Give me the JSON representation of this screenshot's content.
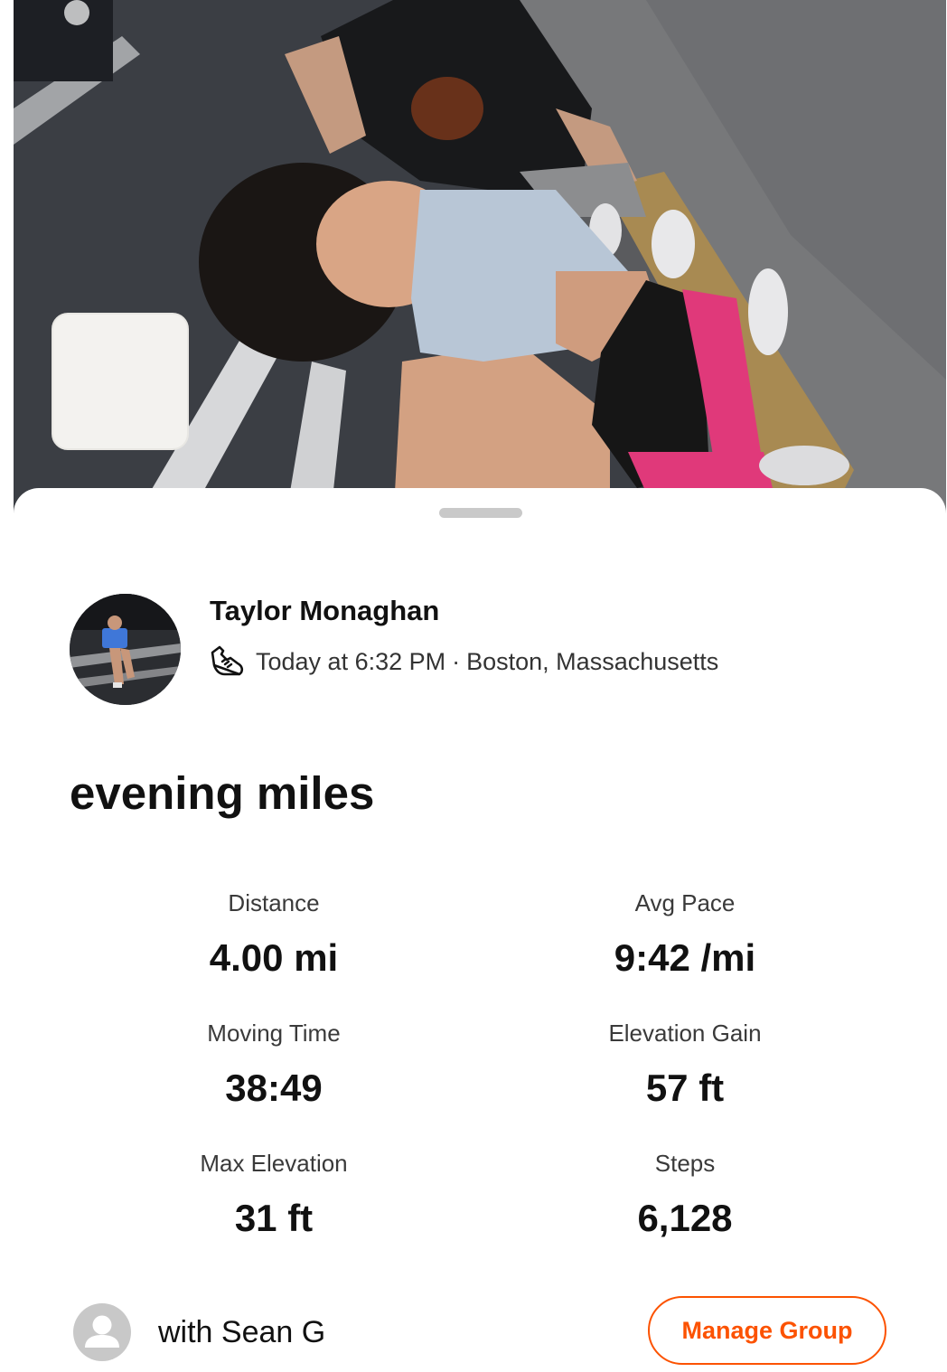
{
  "activity": {
    "athlete_name": "Taylor Monaghan",
    "activity_type_icon": "running-shoe-icon",
    "date_time": "Today at 6:32 PM",
    "separator": "·",
    "location": "Boston, Massachusetts",
    "title": "evening miles"
  },
  "stats": [
    {
      "label": "Distance",
      "value": "4.00 mi"
    },
    {
      "label": "Avg Pace",
      "value": "9:42 /mi"
    },
    {
      "label": "Moving Time",
      "value": "38:49"
    },
    {
      "label": "Elevation Gain",
      "value": "57 ft"
    },
    {
      "label": "Max Elevation",
      "value": "31 ft"
    },
    {
      "label": "Steps",
      "value": "6,128"
    }
  ],
  "group": {
    "with_text": "with Sean G",
    "manage_label": "Manage Group",
    "avatar_icon": "default-user-avatar-icon"
  },
  "colors": {
    "accent": "#fc5200",
    "sheet_background": "#ffffff",
    "map_thumbnail": "#f3f2ef",
    "drag_handle": "#c9c9c9"
  }
}
